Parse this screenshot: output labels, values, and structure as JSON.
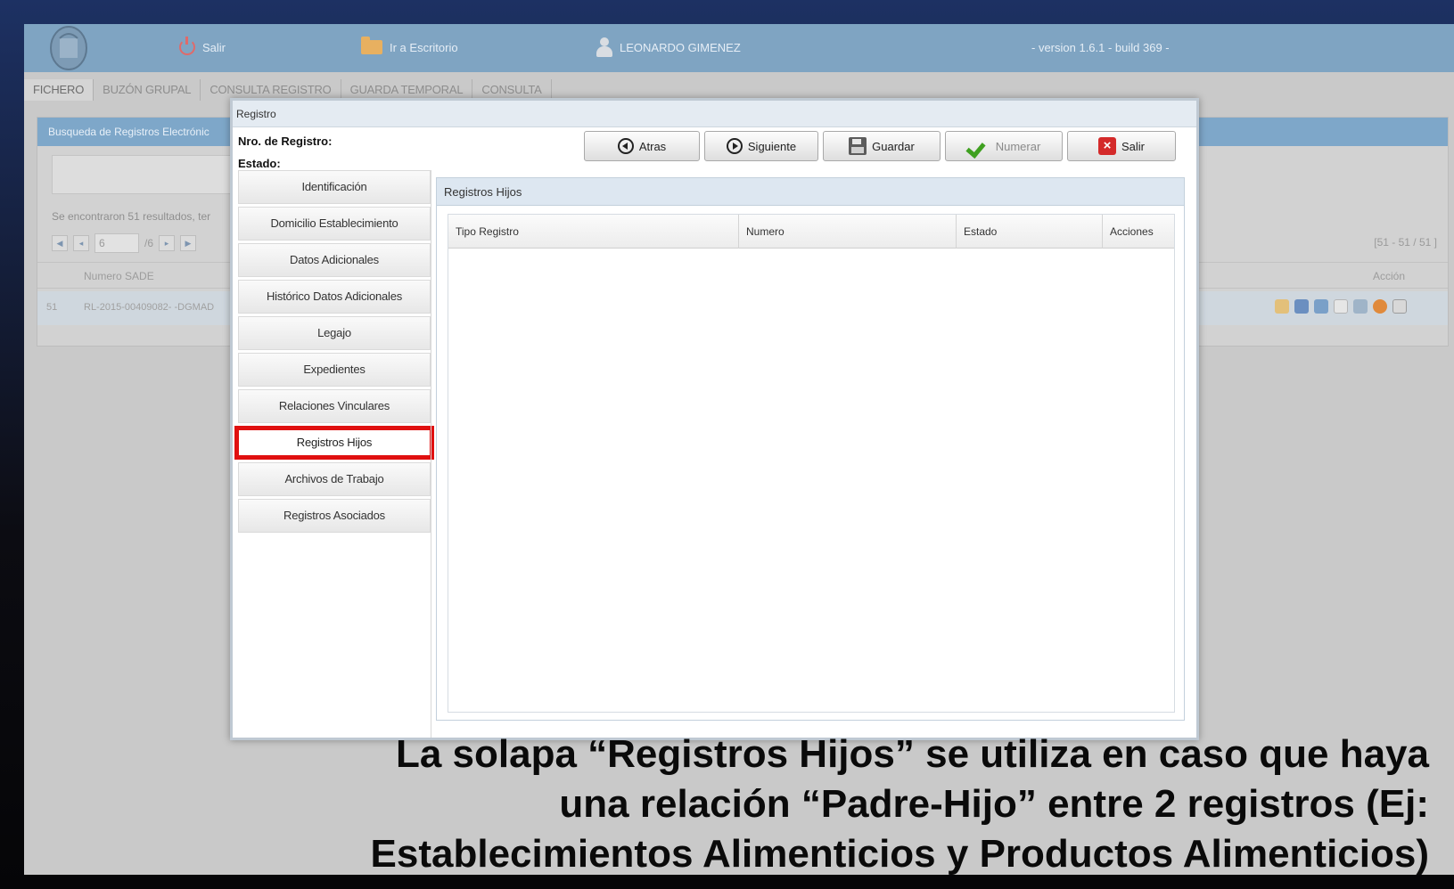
{
  "appbar": {
    "exit_label": "Salir",
    "desk_label": "Ir a Escritorio",
    "user_label": "LEONARDO GIMENEZ",
    "version_label": "- version 1.6.1 - build 369 -"
  },
  "module_tabs": [
    "FICHERO",
    "BUZÓN GRUPAL",
    "CONSULTA REGISTRO",
    "GUARDA TEMPORAL",
    "CONSULTA"
  ],
  "background": {
    "panel_title": "Busqueda de Registros Electrónic",
    "results_text": "Se encontraron 51 resultados, ter",
    "page_input": "6",
    "page_total": "/6",
    "range_text": "[51 - 51 / 51 ]",
    "col_numero": "Numero SADE",
    "col_accion": "Acción",
    "row_index": "51",
    "row_numero": "RL-2015-00409082- -DGMAD"
  },
  "modal": {
    "title": "Registro",
    "nro_label": "Nro. de Registro:",
    "estado_label": "Estado:",
    "buttons": {
      "atras": "Atras",
      "siguiente": "Siguiente",
      "guardar": "Guardar",
      "numerar": "Numerar",
      "salir": "Salir"
    },
    "nav": [
      "Identificación",
      "Domicilio Establecimiento",
      "Datos Adicionales",
      "Histórico Datos Adicionales",
      "Legajo",
      "Expedientes",
      "Relaciones Vinculares",
      "Registros Hijos",
      "Archivos de Trabajo",
      "Registros Asociados"
    ],
    "pane_title": "Registros Hijos",
    "columns": [
      "Tipo Registro",
      "Numero",
      "Estado",
      "Acciones"
    ]
  },
  "caption": {
    "line1": "La solapa “Registros Hijos” se utiliza en caso que haya",
    "line2": "una relación “Padre-Hijo” entre 2 registros (Ej:",
    "line3": "Establecimientos Alimenticios y Productos Alimenticios)"
  },
  "colors": {
    "appbar": "#7fa4c2",
    "highlight": "#e01010",
    "pane_header": "#dde7f1"
  }
}
